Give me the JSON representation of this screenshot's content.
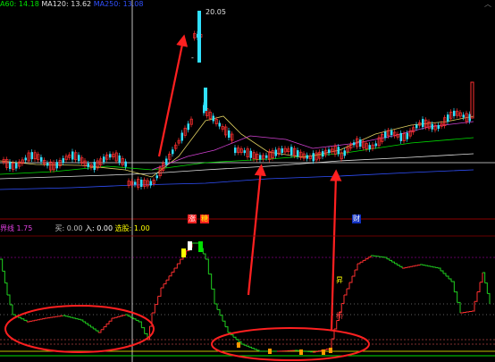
{
  "header": {
    "ma60": "A60: 14.18",
    "ma120": "MA120: 13.62",
    "ma250": "MA250: 13.08",
    "ma60_color": "#00e000",
    "ma120_color": "#e0e0e0",
    "ma250_color": "#3050ff"
  },
  "price_panel": {
    "peak_label": "20.05",
    "dash_label": "-",
    "markers": [
      "涨",
      "糖",
      "财"
    ]
  },
  "indicator_panel": {
    "name": "界线",
    "value": "1.75",
    "buy_label": "买: 0.00",
    "entry_label": "入: 0.00",
    "select_label": "选股: 1.00",
    "side_label_1": "昇",
    "side_label_2": "桥"
  },
  "top_right_icon": "chevron-up-icon",
  "colors": {
    "up": "#ff3030",
    "down": "#30e0ff",
    "arrow": "#ff2020",
    "ellipse": "#ff2020",
    "indicator_up": "#ff3030",
    "indicator_down": "#20d020",
    "yellow": "#ffff00",
    "orange": "#ff9900"
  }
}
